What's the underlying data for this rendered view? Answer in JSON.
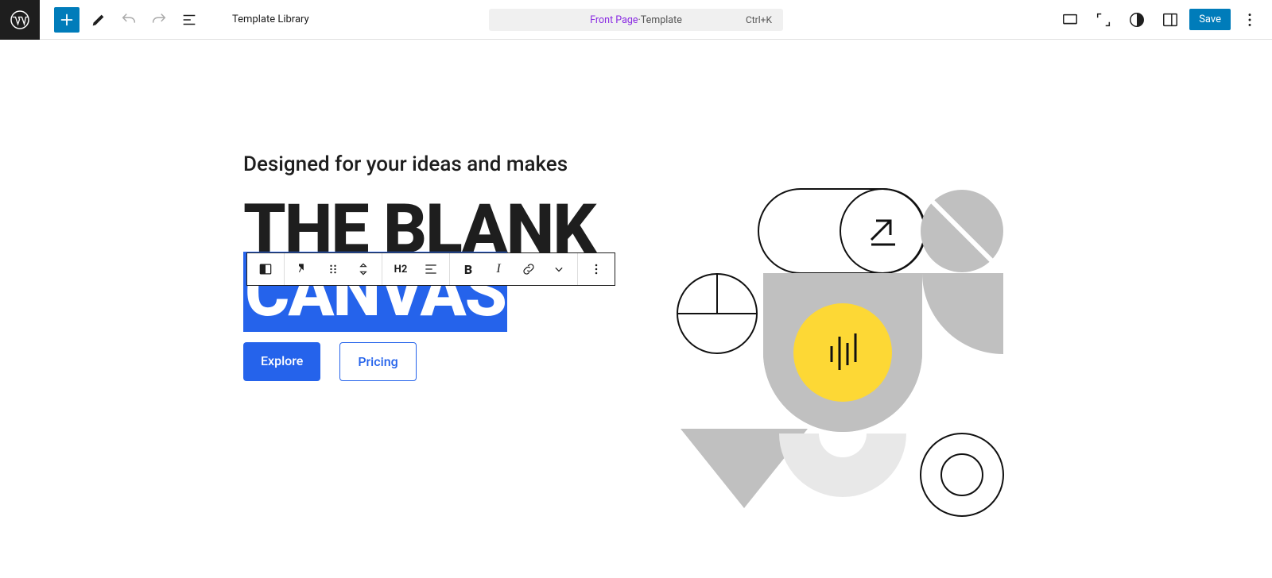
{
  "topbar": {
    "template_library": "Template Library",
    "center_title_a": "Front Page",
    "center_title_sep": " · ",
    "center_title_b": "Template",
    "shortcut": "Ctrl+K",
    "save": "Save"
  },
  "block_toolbar": {
    "heading_level": "H2"
  },
  "content": {
    "subhead": "Designed for your ideas and makes",
    "h2_line1": "THE BLANK",
    "h2_line2_selected": "CANVAS",
    "button_primary": "Explore",
    "button_secondary": "Pricing"
  },
  "colors": {
    "accent": "#2563eb",
    "wp_blue": "#007cba",
    "yellow": "#fdd835"
  }
}
